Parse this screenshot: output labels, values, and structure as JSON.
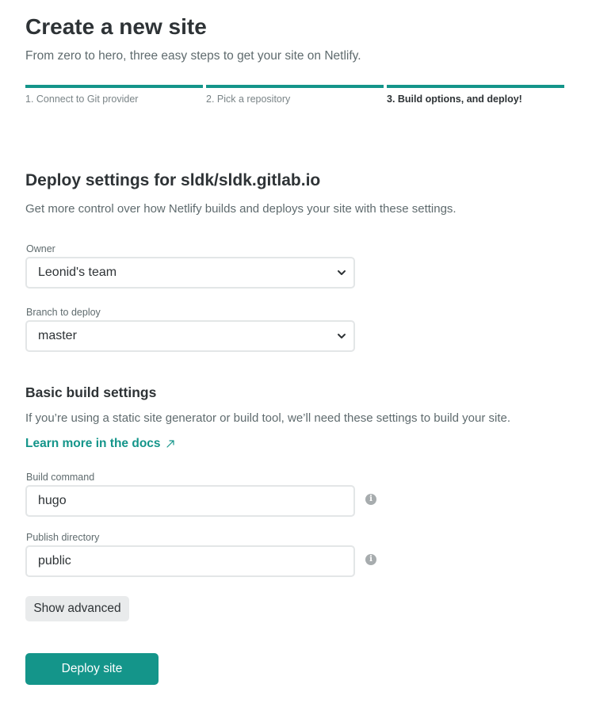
{
  "header": {
    "title": "Create a new site",
    "subtitle": "From zero to hero, three easy steps to get your site on Netlify."
  },
  "steps": [
    {
      "label": "1. Connect to Git provider",
      "state": "completed"
    },
    {
      "label": "2. Pick a repository",
      "state": "completed"
    },
    {
      "label": "3. Build options, and deploy!",
      "state": "active"
    }
  ],
  "deploy_settings": {
    "title": "Deploy settings for sldk/sldk.gitlab.io",
    "description": "Get more control over how Netlify builds and deploys your site with these settings.",
    "owner": {
      "label": "Owner",
      "value": "Leonid's team"
    },
    "branch": {
      "label": "Branch to deploy",
      "value": "master"
    }
  },
  "build_settings": {
    "title": "Basic build settings",
    "description": "If you’re using a static site generator or build tool, we’ll need these settings to build your site.",
    "learn_more": "Learn more in the docs",
    "build_command": {
      "label": "Build command",
      "value": "hugo"
    },
    "publish_directory": {
      "label": "Publish directory",
      "value": "public"
    }
  },
  "actions": {
    "show_advanced": "Show advanced",
    "deploy": "Deploy site"
  },
  "colors": {
    "accent": "#14958a",
    "text": "#2e3336",
    "muted": "#5f6b6e"
  },
  "icons": [
    "chevron-down-icon",
    "external-link-icon",
    "info-icon"
  ]
}
